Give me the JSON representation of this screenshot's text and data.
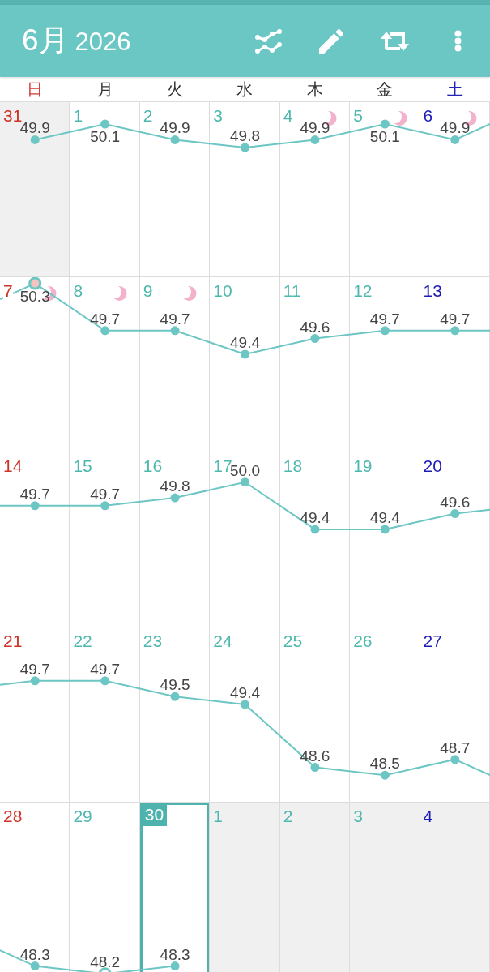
{
  "app_bar": {
    "month": "6月",
    "year": "2026"
  },
  "weekdays": [
    "日",
    "月",
    "火",
    "水",
    "木",
    "金",
    "土"
  ],
  "weeks": [
    {
      "days": [
        {
          "date": "31",
          "outside_month": true,
          "selected": false,
          "crescent": false,
          "weight": "49.9",
          "ring": false,
          "pink_fill": false
        },
        {
          "date": "1",
          "outside_month": false,
          "selected": false,
          "crescent": false,
          "weight": "50.1",
          "ring": false,
          "pink_fill": false
        },
        {
          "date": "2",
          "outside_month": false,
          "selected": false,
          "crescent": false,
          "weight": "49.9",
          "ring": false,
          "pink_fill": false
        },
        {
          "date": "3",
          "outside_month": false,
          "selected": false,
          "crescent": false,
          "weight": "49.8",
          "ring": false,
          "pink_fill": false
        },
        {
          "date": "4",
          "outside_month": false,
          "selected": false,
          "crescent": true,
          "weight": "49.9",
          "ring": false,
          "pink_fill": false
        },
        {
          "date": "5",
          "outside_month": false,
          "selected": false,
          "crescent": true,
          "weight": "50.1",
          "ring": false,
          "pink_fill": false
        },
        {
          "date": "6",
          "outside_month": false,
          "selected": false,
          "crescent": true,
          "weight": "49.9",
          "ring": false,
          "pink_fill": false
        }
      ]
    },
    {
      "days": [
        {
          "date": "7",
          "outside_month": false,
          "selected": false,
          "crescent": true,
          "weight": "50.3",
          "ring": true,
          "pink_fill": true
        },
        {
          "date": "8",
          "outside_month": false,
          "selected": false,
          "crescent": true,
          "weight": "49.7",
          "ring": false,
          "pink_fill": false
        },
        {
          "date": "9",
          "outside_month": false,
          "selected": false,
          "crescent": true,
          "weight": "49.7",
          "ring": false,
          "pink_fill": false
        },
        {
          "date": "10",
          "outside_month": false,
          "selected": false,
          "crescent": false,
          "weight": "49.4",
          "ring": false,
          "pink_fill": false
        },
        {
          "date": "11",
          "outside_month": false,
          "selected": false,
          "crescent": false,
          "weight": "49.6",
          "ring": false,
          "pink_fill": false
        },
        {
          "date": "12",
          "outside_month": false,
          "selected": false,
          "crescent": false,
          "weight": "49.7",
          "ring": false,
          "pink_fill": false
        },
        {
          "date": "13",
          "outside_month": false,
          "selected": false,
          "crescent": false,
          "weight": "49.7",
          "ring": false,
          "pink_fill": false
        }
      ]
    },
    {
      "days": [
        {
          "date": "14",
          "outside_month": false,
          "selected": false,
          "crescent": false,
          "weight": "49.7",
          "ring": false,
          "pink_fill": false
        },
        {
          "date": "15",
          "outside_month": false,
          "selected": false,
          "crescent": false,
          "weight": "49.7",
          "ring": false,
          "pink_fill": false
        },
        {
          "date": "16",
          "outside_month": false,
          "selected": false,
          "crescent": false,
          "weight": "49.8",
          "ring": false,
          "pink_fill": false
        },
        {
          "date": "17",
          "outside_month": false,
          "selected": false,
          "crescent": false,
          "weight": "50.0",
          "ring": false,
          "pink_fill": false
        },
        {
          "date": "18",
          "outside_month": false,
          "selected": false,
          "crescent": false,
          "weight": "49.4",
          "ring": false,
          "pink_fill": false
        },
        {
          "date": "19",
          "outside_month": false,
          "selected": false,
          "crescent": false,
          "weight": "49.4",
          "ring": false,
          "pink_fill": false
        },
        {
          "date": "20",
          "outside_month": false,
          "selected": false,
          "crescent": false,
          "weight": "49.6",
          "ring": false,
          "pink_fill": false
        }
      ]
    },
    {
      "days": [
        {
          "date": "21",
          "outside_month": false,
          "selected": false,
          "crescent": false,
          "weight": "49.7",
          "ring": false,
          "pink_fill": false
        },
        {
          "date": "22",
          "outside_month": false,
          "selected": false,
          "crescent": false,
          "weight": "49.7",
          "ring": false,
          "pink_fill": false
        },
        {
          "date": "23",
          "outside_month": false,
          "selected": false,
          "crescent": false,
          "weight": "49.5",
          "ring": false,
          "pink_fill": false
        },
        {
          "date": "24",
          "outside_month": false,
          "selected": false,
          "crescent": false,
          "weight": "49.4",
          "ring": false,
          "pink_fill": false
        },
        {
          "date": "25",
          "outside_month": false,
          "selected": false,
          "crescent": false,
          "weight": "48.6",
          "ring": false,
          "pink_fill": false
        },
        {
          "date": "26",
          "outside_month": false,
          "selected": false,
          "crescent": false,
          "weight": "48.5",
          "ring": false,
          "pink_fill": false
        },
        {
          "date": "27",
          "outside_month": false,
          "selected": false,
          "crescent": false,
          "weight": "48.7",
          "ring": false,
          "pink_fill": false
        }
      ]
    },
    {
      "days": [
        {
          "date": "28",
          "outside_month": false,
          "selected": false,
          "crescent": false,
          "weight": "48.3",
          "ring": false,
          "pink_fill": false
        },
        {
          "date": "29",
          "outside_month": false,
          "selected": false,
          "crescent": false,
          "weight": "48.2",
          "ring": true,
          "pink_fill": false
        },
        {
          "date": "30",
          "outside_month": false,
          "selected": true,
          "crescent": false,
          "weight": "48.3",
          "ring": false,
          "pink_fill": false
        },
        {
          "date": "1",
          "outside_month": true,
          "selected": false,
          "crescent": false
        },
        {
          "date": "2",
          "outside_month": true,
          "selected": false,
          "crescent": false
        },
        {
          "date": "3",
          "outside_month": true,
          "selected": false,
          "crescent": false
        },
        {
          "date": "4",
          "outside_month": true,
          "selected": false,
          "crescent": false
        }
      ]
    }
  ]
}
